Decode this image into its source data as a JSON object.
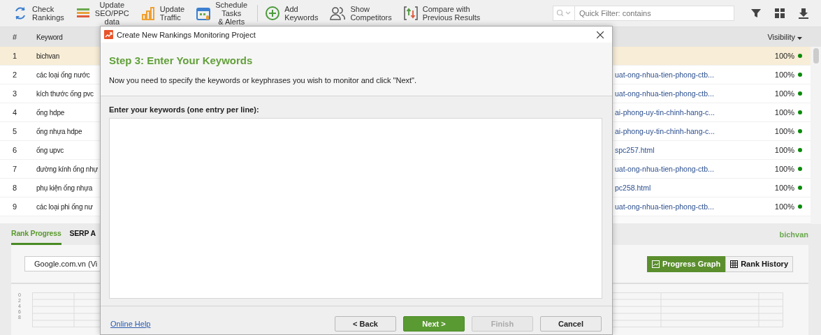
{
  "toolbar": {
    "items": [
      {
        "label": "Check Rankings",
        "kind": "refresh"
      },
      {
        "label": "Update SEO/PPC data",
        "kind": "bars"
      },
      {
        "label": "Update Traffic",
        "kind": "chart"
      },
      {
        "label": "Schedule Tasks & Alerts",
        "kind": "calendar"
      },
      {
        "label": "Add Keywords",
        "kind": "add"
      },
      {
        "label": "Show Competitors",
        "kind": "people"
      },
      {
        "label": "Compare with Previous Results",
        "kind": "compare"
      }
    ],
    "quick_filter": {
      "placeholder": "Quick Filter: contains"
    }
  },
  "table": {
    "columns": [
      "#",
      "Keyword",
      "Visibility"
    ],
    "rows": [
      {
        "num": "1",
        "keyword": "bichvan",
        "url": "",
        "visibility": "100%",
        "selected": true
      },
      {
        "num": "2",
        "keyword": "các loại ống nước",
        "url": "uat-ong-nhua-tien-phong-ctb...",
        "visibility": "100%",
        "selected": false
      },
      {
        "num": "3",
        "keyword": "kích thước ống pvc",
        "url": "uat-ong-nhua-tien-phong-ctb...",
        "visibility": "100%",
        "selected": false
      },
      {
        "num": "4",
        "keyword": "ống hdpe",
        "url": "ai-phong-uy-tin-chinh-hang-c...",
        "visibility": "100%",
        "selected": false
      },
      {
        "num": "5",
        "keyword": "ống nhựa hdpe",
        "url": "ai-phong-uy-tin-chinh-hang-c...",
        "visibility": "100%",
        "selected": false
      },
      {
        "num": "6",
        "keyword": "ống upvc",
        "url": "spc257.html",
        "visibility": "100%",
        "selected": false
      },
      {
        "num": "7",
        "keyword": "đường kính ống nhự",
        "url": "uat-ong-nhua-tien-phong-ctb...",
        "visibility": "100%",
        "selected": false
      },
      {
        "num": "8",
        "keyword": "phụ kiện ống nhựa",
        "url": "pc258.html",
        "visibility": "100%",
        "selected": false
      },
      {
        "num": "9",
        "keyword": "các loại phi ống nư",
        "url": "uat-ong-nhua-tien-phong-ctb...",
        "visibility": "100%",
        "selected": false
      }
    ]
  },
  "bottom_panel": {
    "tabs": [
      {
        "label": "Rank Progress",
        "selected": true
      },
      {
        "label": "SERP A",
        "selected": false
      }
    ],
    "project": "bichvan",
    "search_engine": "Google.com.vn (Vi",
    "views": [
      {
        "label": "Progress Graph",
        "kind": "graph",
        "selected": true
      },
      {
        "label": "Rank History",
        "kind": "table",
        "selected": false
      }
    ],
    "y_ticks": [
      "0",
      "2",
      "4",
      "6",
      "8"
    ]
  },
  "dialog": {
    "title": "Create New Rankings Monitoring Project",
    "heading": "Step 3: Enter Your Keywords",
    "description": "Now you need to specify the keywords or keyphrases you wish to monitor and click \"Next\".",
    "field_label": "Enter your keywords (one entry per line):",
    "help_link": "Online Help",
    "buttons": [
      {
        "label": "< Back",
        "primary": false,
        "disabled": false
      },
      {
        "label": "Next >",
        "primary": true,
        "disabled": false
      },
      {
        "label": "Finish",
        "primary": false,
        "disabled": true
      },
      {
        "label": "Cancel",
        "primary": false,
        "disabled": false
      }
    ]
  }
}
